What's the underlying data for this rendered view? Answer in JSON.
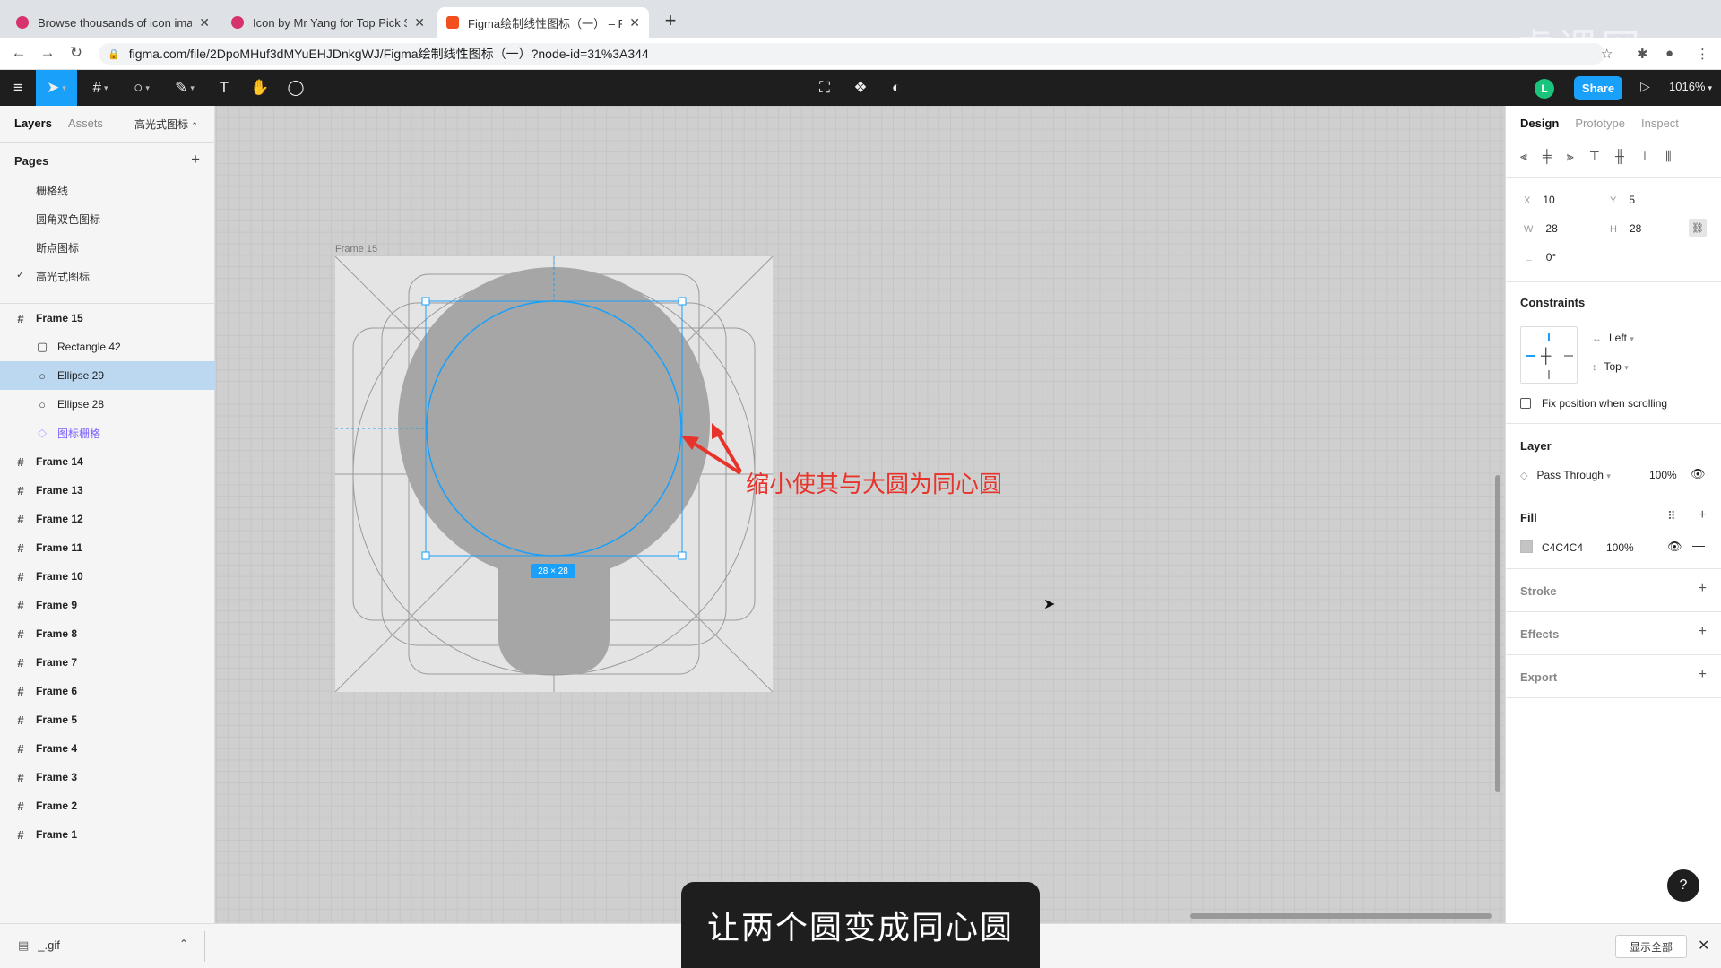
{
  "browser": {
    "tabs": [
      {
        "title": "Browse thousands of icon imag",
        "favicon_color": "#d6336c"
      },
      {
        "title": "Icon by Mr Yang for Top Pick S",
        "favicon_color": "#d6336c"
      },
      {
        "title": "Figma绘制线性图标（一） – Fig",
        "favicon_color": "#f24e1e"
      }
    ],
    "url": "figma.com/file/2DpoMHuf3dMYuEHJDnkgWJ/Figma绘制线性图标（一）?node-id=31%3A344"
  },
  "watermark": "虎课网",
  "toolbar": {
    "avatar_letter": "L",
    "share_label": "Share",
    "zoom": "1016%"
  },
  "left_panel": {
    "tabs": [
      "Layers",
      "Assets"
    ],
    "current_page": "高光式图标",
    "pages_heading": "Pages",
    "pages": [
      "栅格线",
      "圆角双色图标",
      "断点图标",
      "高光式图标"
    ],
    "layers": [
      {
        "name": "Frame 15",
        "kind": "frame"
      },
      {
        "name": "Rectangle 42",
        "kind": "rect"
      },
      {
        "name": "Ellipse 29",
        "kind": "ellipse"
      },
      {
        "name": "Ellipse 28",
        "kind": "ellipse"
      },
      {
        "name": "图标栅格",
        "kind": "component"
      },
      {
        "name": "Frame 14",
        "kind": "frame"
      },
      {
        "name": "Frame 13",
        "kind": "frame"
      },
      {
        "name": "Frame 12",
        "kind": "frame"
      },
      {
        "name": "Frame 11",
        "kind": "frame"
      },
      {
        "name": "Frame 10",
        "kind": "frame"
      },
      {
        "name": "Frame 9",
        "kind": "frame"
      },
      {
        "name": "Frame 8",
        "kind": "frame"
      },
      {
        "name": "Frame 7",
        "kind": "frame"
      },
      {
        "name": "Frame 6",
        "kind": "frame"
      },
      {
        "name": "Frame 5",
        "kind": "frame"
      },
      {
        "name": "Frame 4",
        "kind": "frame"
      },
      {
        "name": "Frame 3",
        "kind": "frame"
      },
      {
        "name": "Frame 2",
        "kind": "frame"
      },
      {
        "name": "Frame 1",
        "kind": "frame"
      }
    ]
  },
  "canvas": {
    "frame_label": "Frame 15",
    "annotation": "缩小使其与大圆为同心圆",
    "size_badge": "28 × 28",
    "accent": "#18a0fb",
    "annotation_color": "#e8332a"
  },
  "right_panel": {
    "tabs": [
      "Design",
      "Prototype",
      "Inspect"
    ],
    "x_label": "X",
    "x": "10",
    "y_label": "Y",
    "y": "5",
    "w_label": "W",
    "w": "28",
    "h_label": "H",
    "h": "28",
    "rotation": "0°",
    "constraints_heading": "Constraints",
    "constraint_h": "Left",
    "constraint_v": "Top",
    "fix_position": "Fix position when scrolling",
    "layer_heading": "Layer",
    "blend": "Pass Through",
    "layer_opacity": "100%",
    "fill_heading": "Fill",
    "fill_hex": "C4C4C4",
    "fill_opacity": "100%",
    "stroke_heading": "Stroke",
    "effects_heading": "Effects",
    "export_heading": "Export"
  },
  "bottom": {
    "download_file": "_.gif",
    "show_all": "显示全部",
    "subtitle": "让两个圆变成同心圆"
  }
}
